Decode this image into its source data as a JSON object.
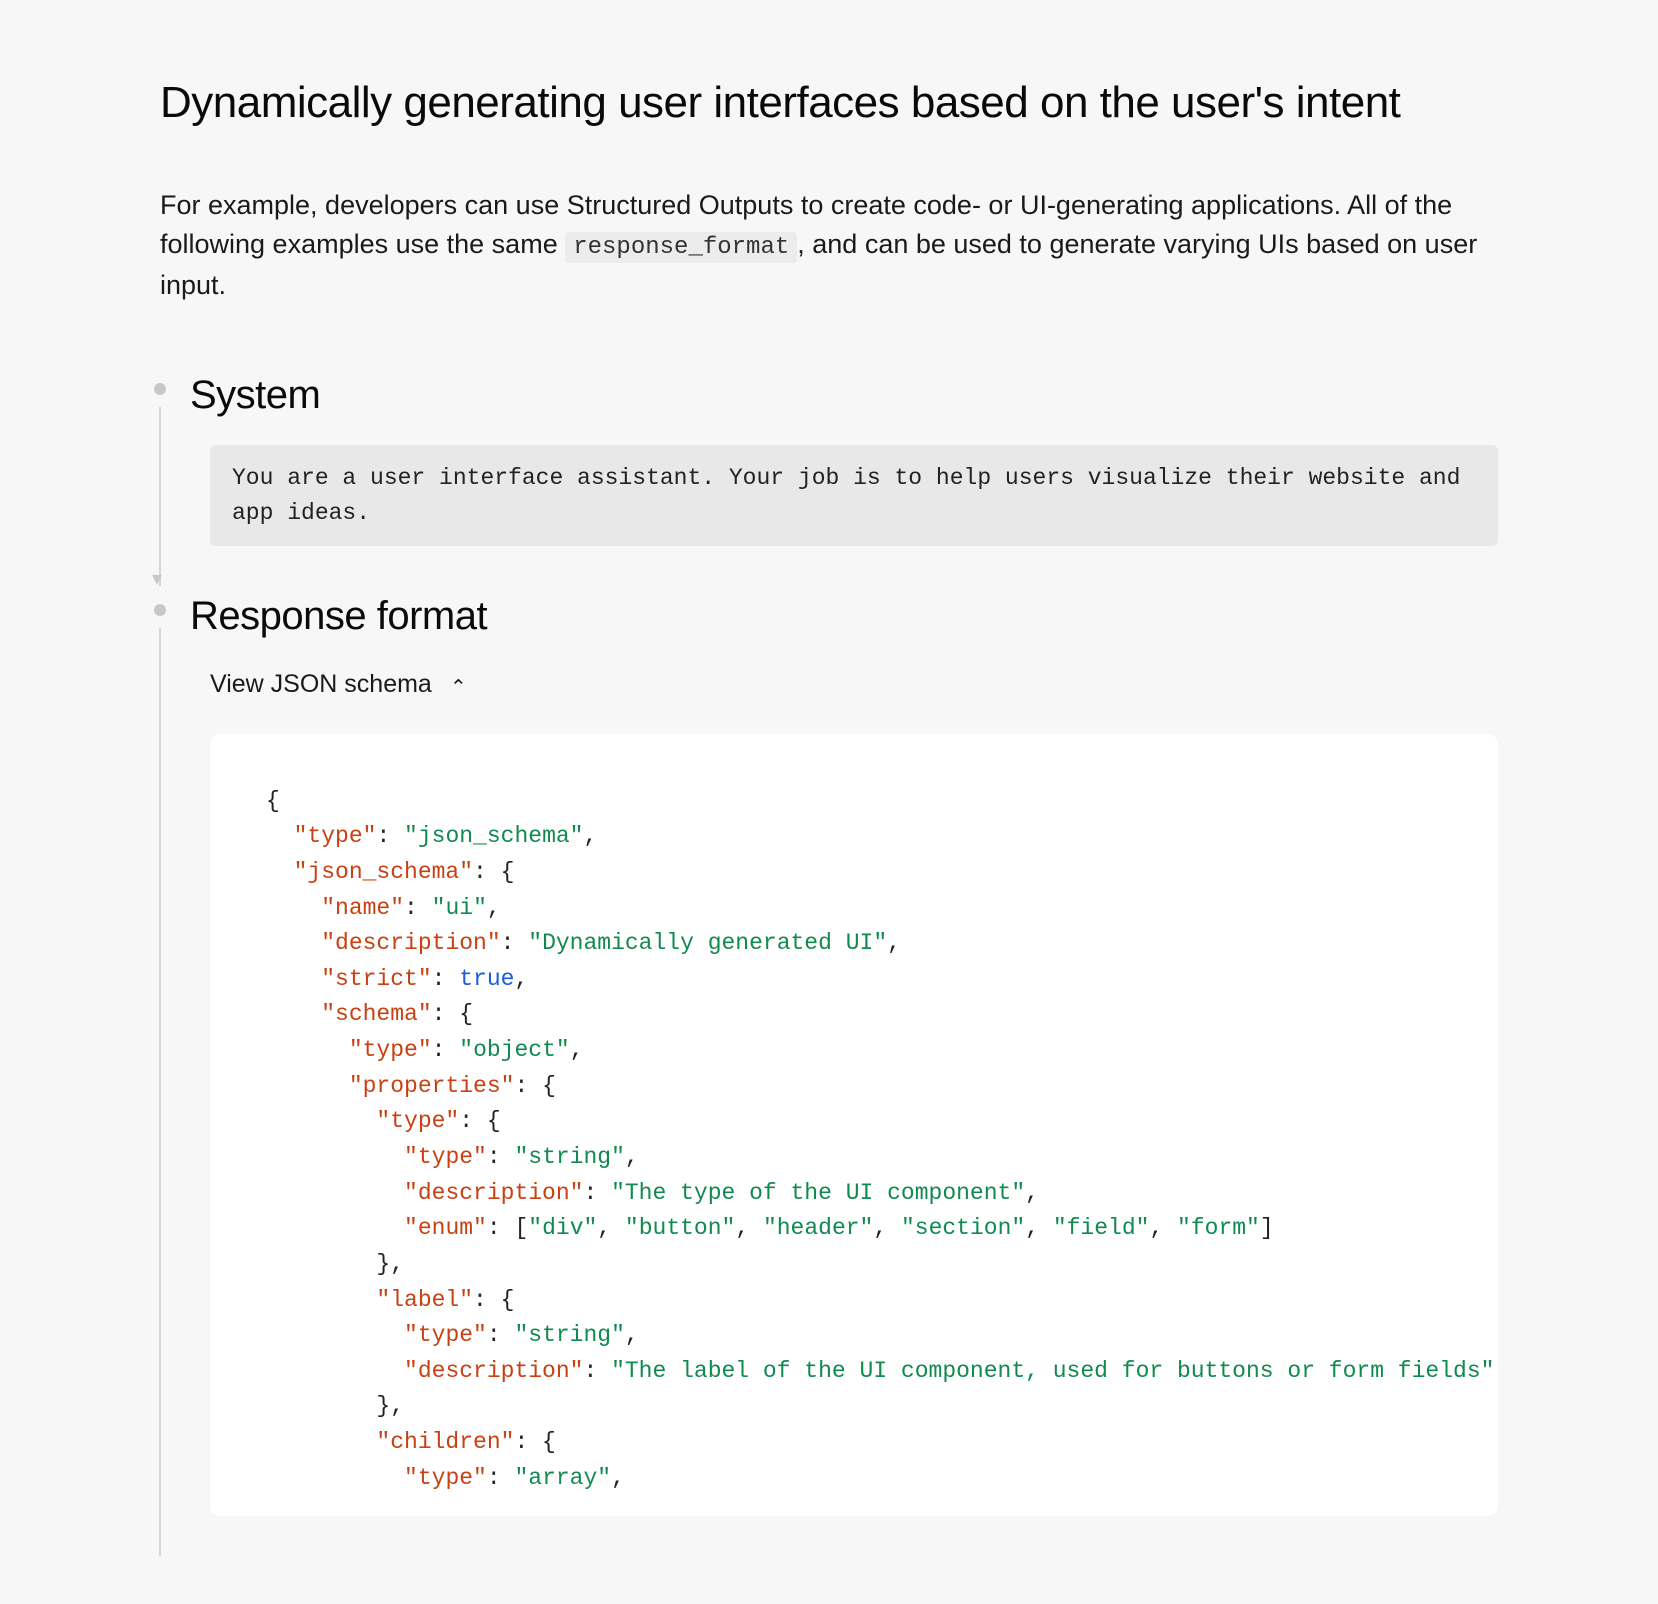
{
  "title": "Dynamically generating user interfaces based on the user's intent",
  "intro_part1": "For example, developers can use Structured Outputs to create code- or UI-generating applications. All of the following examples use the same ",
  "intro_code": "response_format",
  "intro_part2": ", and can be used to generate varying UIs based on user input.",
  "sections": {
    "system": {
      "heading": "System",
      "content": "You are a user interface assistant. Your job is to help users visualize their website and app ideas."
    },
    "response_format": {
      "heading": "Response format",
      "toggle_label": "View JSON schema",
      "schema_tokens": [
        {
          "t": "punct",
          "v": "{"
        },
        {
          "t": "nl"
        },
        {
          "t": "indent",
          "n": 1
        },
        {
          "t": "key",
          "v": "\"type\""
        },
        {
          "t": "punct",
          "v": ": "
        },
        {
          "t": "str",
          "v": "\"json_schema\""
        },
        {
          "t": "punct",
          "v": ","
        },
        {
          "t": "nl"
        },
        {
          "t": "indent",
          "n": 1
        },
        {
          "t": "key",
          "v": "\"json_schema\""
        },
        {
          "t": "punct",
          "v": ": {"
        },
        {
          "t": "nl"
        },
        {
          "t": "indent",
          "n": 2
        },
        {
          "t": "key",
          "v": "\"name\""
        },
        {
          "t": "punct",
          "v": ": "
        },
        {
          "t": "str",
          "v": "\"ui\""
        },
        {
          "t": "punct",
          "v": ","
        },
        {
          "t": "nl"
        },
        {
          "t": "indent",
          "n": 2
        },
        {
          "t": "key",
          "v": "\"description\""
        },
        {
          "t": "punct",
          "v": ": "
        },
        {
          "t": "str",
          "v": "\"Dynamically generated UI\""
        },
        {
          "t": "punct",
          "v": ","
        },
        {
          "t": "nl"
        },
        {
          "t": "indent",
          "n": 2
        },
        {
          "t": "key",
          "v": "\"strict\""
        },
        {
          "t": "punct",
          "v": ": "
        },
        {
          "t": "bool",
          "v": "true"
        },
        {
          "t": "punct",
          "v": ","
        },
        {
          "t": "nl"
        },
        {
          "t": "indent",
          "n": 2
        },
        {
          "t": "key",
          "v": "\"schema\""
        },
        {
          "t": "punct",
          "v": ": {"
        },
        {
          "t": "nl"
        },
        {
          "t": "indent",
          "n": 3
        },
        {
          "t": "key",
          "v": "\"type\""
        },
        {
          "t": "punct",
          "v": ": "
        },
        {
          "t": "str",
          "v": "\"object\""
        },
        {
          "t": "punct",
          "v": ","
        },
        {
          "t": "nl"
        },
        {
          "t": "indent",
          "n": 3
        },
        {
          "t": "key",
          "v": "\"properties\""
        },
        {
          "t": "punct",
          "v": ": {"
        },
        {
          "t": "nl"
        },
        {
          "t": "indent",
          "n": 4
        },
        {
          "t": "key",
          "v": "\"type\""
        },
        {
          "t": "punct",
          "v": ": {"
        },
        {
          "t": "nl"
        },
        {
          "t": "indent",
          "n": 5
        },
        {
          "t": "key",
          "v": "\"type\""
        },
        {
          "t": "punct",
          "v": ": "
        },
        {
          "t": "str",
          "v": "\"string\""
        },
        {
          "t": "punct",
          "v": ","
        },
        {
          "t": "nl"
        },
        {
          "t": "indent",
          "n": 5
        },
        {
          "t": "key",
          "v": "\"description\""
        },
        {
          "t": "punct",
          "v": ": "
        },
        {
          "t": "str",
          "v": "\"The type of the UI component\""
        },
        {
          "t": "punct",
          "v": ","
        },
        {
          "t": "nl"
        },
        {
          "t": "indent",
          "n": 5
        },
        {
          "t": "key",
          "v": "\"enum\""
        },
        {
          "t": "punct",
          "v": ": ["
        },
        {
          "t": "str",
          "v": "\"div\""
        },
        {
          "t": "punct",
          "v": ", "
        },
        {
          "t": "str",
          "v": "\"button\""
        },
        {
          "t": "punct",
          "v": ", "
        },
        {
          "t": "str",
          "v": "\"header\""
        },
        {
          "t": "punct",
          "v": ", "
        },
        {
          "t": "str",
          "v": "\"section\""
        },
        {
          "t": "punct",
          "v": ", "
        },
        {
          "t": "str",
          "v": "\"field\""
        },
        {
          "t": "punct",
          "v": ", "
        },
        {
          "t": "str",
          "v": "\"form\""
        },
        {
          "t": "punct",
          "v": "]"
        },
        {
          "t": "nl"
        },
        {
          "t": "indent",
          "n": 4
        },
        {
          "t": "punct",
          "v": "},"
        },
        {
          "t": "nl"
        },
        {
          "t": "indent",
          "n": 4
        },
        {
          "t": "key",
          "v": "\"label\""
        },
        {
          "t": "punct",
          "v": ": {"
        },
        {
          "t": "nl"
        },
        {
          "t": "indent",
          "n": 5
        },
        {
          "t": "key",
          "v": "\"type\""
        },
        {
          "t": "punct",
          "v": ": "
        },
        {
          "t": "str",
          "v": "\"string\""
        },
        {
          "t": "punct",
          "v": ","
        },
        {
          "t": "nl"
        },
        {
          "t": "indent",
          "n": 5
        },
        {
          "t": "key",
          "v": "\"description\""
        },
        {
          "t": "punct",
          "v": ": "
        },
        {
          "t": "str",
          "v": "\"The label of the UI component, used for buttons or form fields\""
        },
        {
          "t": "nl"
        },
        {
          "t": "indent",
          "n": 4
        },
        {
          "t": "punct",
          "v": "},"
        },
        {
          "t": "nl"
        },
        {
          "t": "indent",
          "n": 4
        },
        {
          "t": "key",
          "v": "\"children\""
        },
        {
          "t": "punct",
          "v": ": {"
        },
        {
          "t": "nl"
        },
        {
          "t": "indent",
          "n": 5
        },
        {
          "t": "key",
          "v": "\"type\""
        },
        {
          "t": "punct",
          "v": ": "
        },
        {
          "t": "str",
          "v": "\"array\""
        },
        {
          "t": "punct",
          "v": ","
        },
        {
          "t": "nl"
        }
      ]
    }
  }
}
